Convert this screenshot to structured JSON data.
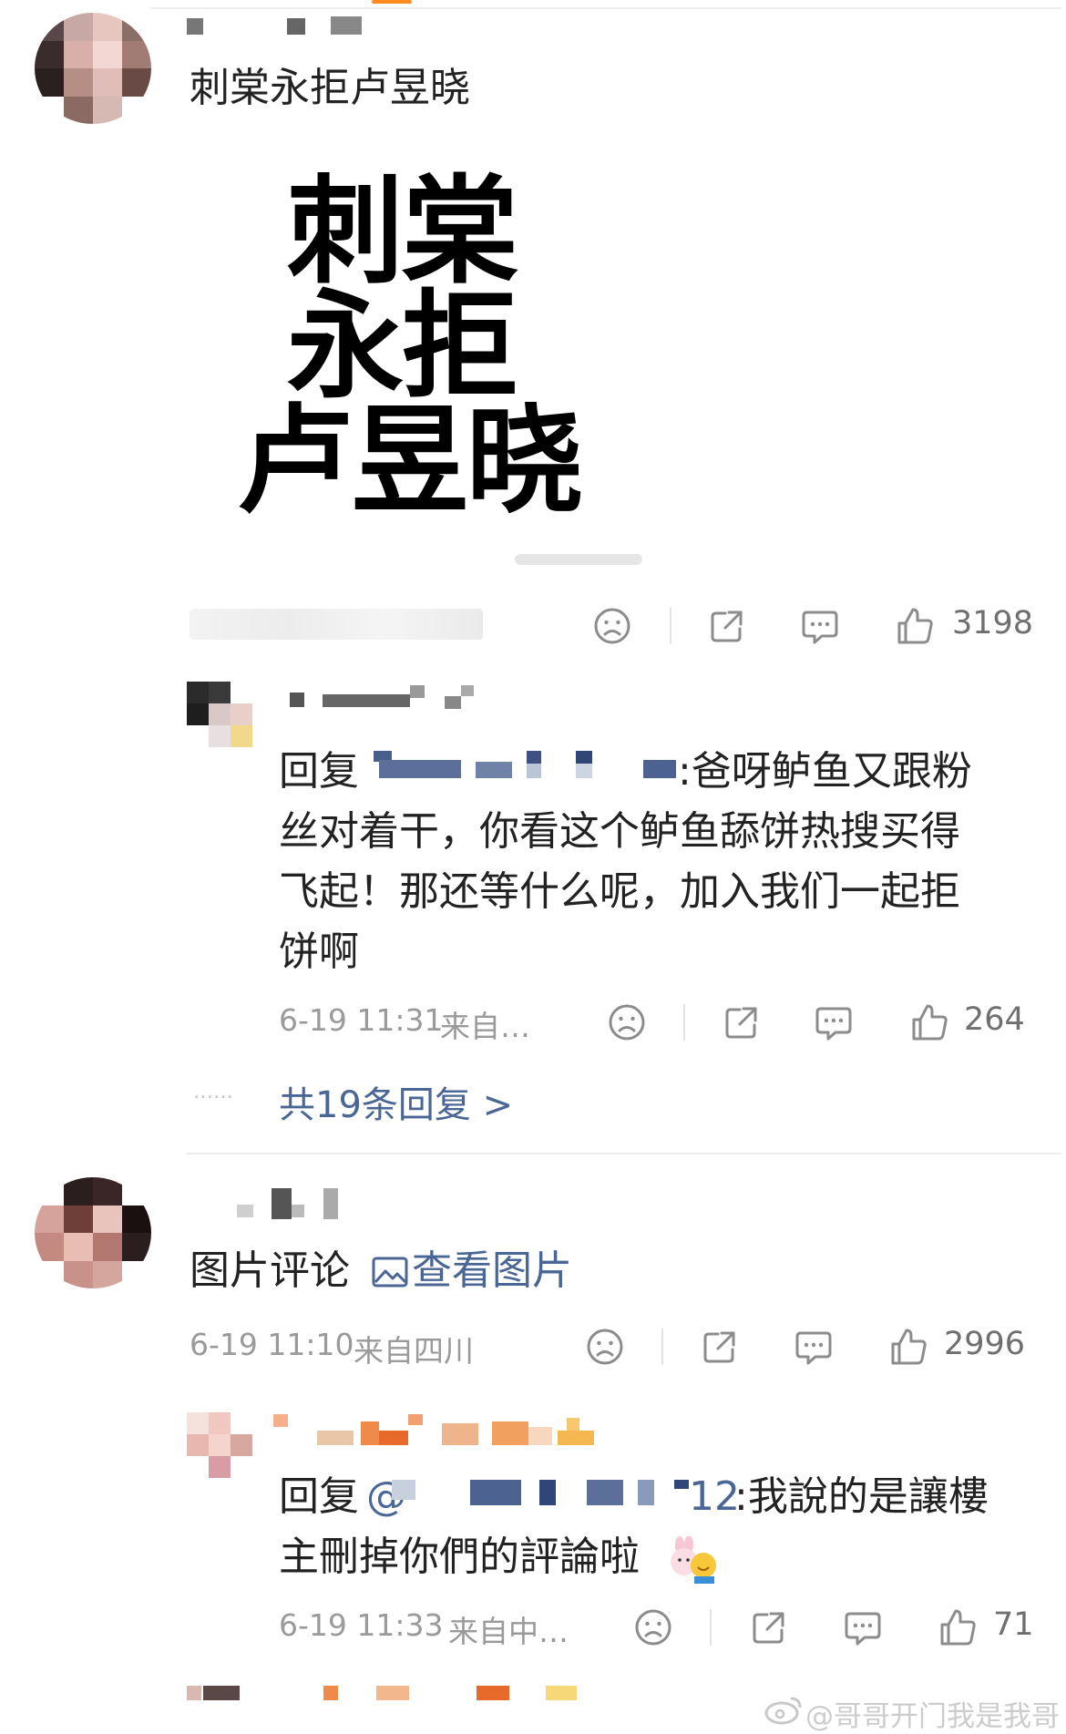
{
  "post": {
    "text": "刺棠永拒卢昱晓",
    "meme_lines": [
      "刺棠",
      "永拒",
      "卢昱晓"
    ],
    "like_count": "3198"
  },
  "reply1": {
    "prefix": "回复",
    "text_line1": ":爸呀鲈鱼又跟粉",
    "text_line2": "丝对着干，你看这个鲈鱼舔饼热搜买得",
    "text_line3": "飞起！那还等什么呢，加入我们一起拒",
    "text_line4": "饼啊",
    "time": "6-19 11:31",
    "source": "来自…",
    "like_count": "264",
    "more_dots": "……",
    "more_replies": "共19条回复 >"
  },
  "comment2": {
    "label": "图片评论",
    "view_image": "查看图片",
    "time": "6-19 11:10",
    "source": "来自四川",
    "like_count": "2996"
  },
  "reply2": {
    "prefix": "回复",
    "at": "@",
    "mention_suffix": "12",
    "text_line1": ":我說的是讓樓",
    "text_line2": "主刪掉你們的評論啦",
    "time": "6-19 11:33",
    "source": "来自中…",
    "like_count": "71"
  },
  "watermark": "@哥哥开门我是我哥",
  "icons": [
    "sad-emoji-icon",
    "share-icon",
    "comment-icon",
    "thumbs-up-icon",
    "image-icon",
    "weibo-logo-icon"
  ],
  "colors": {
    "link": "#4a6694",
    "meta": "#9a9a9a",
    "count": "#6f6f6f"
  }
}
